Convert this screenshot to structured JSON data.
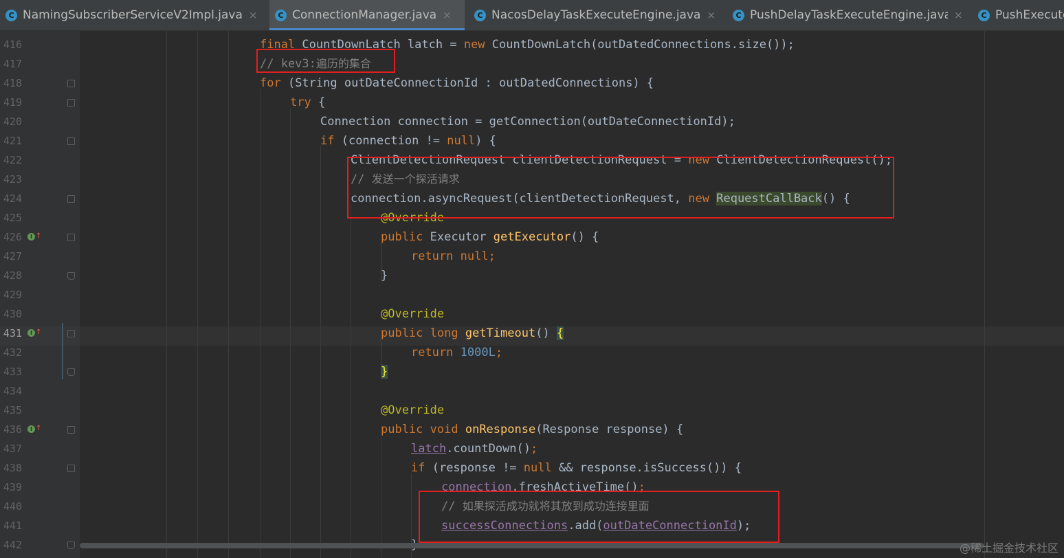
{
  "tabs": [
    {
      "label": "NamingSubscriberServiceV2Impl.java",
      "icon": "class-icon",
      "active": false
    },
    {
      "label": "ConnectionManager.java",
      "icon": "class-icon",
      "active": true
    },
    {
      "label": "NacosDelayTaskExecuteEngine.java",
      "icon": "class-icon",
      "active": false
    },
    {
      "label": "PushDelayTaskExecuteEngine.java",
      "icon": "class-icon",
      "active": false
    },
    {
      "label": "PushExecute",
      "icon": "class-icon",
      "active": false
    }
  ],
  "tab_icon_glyph": "C",
  "tab_close_glyph": "×",
  "current_line": "431",
  "lines": [
    {
      "num": "416",
      "t1": "final ",
      "t2": "CountDownLatch latch = ",
      "t3": "new ",
      "t4": "CountDownLatch(outDatedConnections.size());"
    },
    {
      "num": "417",
      "t1": "// kev3:",
      "t2": "遍历的集合"
    },
    {
      "num": "418",
      "t1": "for ",
      "t2": "(String outDateConnectionId : outDatedConnections) {"
    },
    {
      "num": "419",
      "t1": "try ",
      "t2": "{"
    },
    {
      "num": "420",
      "t1": "Connection connection = getConnection(outDateConnectionId);"
    },
    {
      "num": "421",
      "t1": "if ",
      "t2": "(connection != ",
      "t3": "null",
      "t4": ") {"
    },
    {
      "num": "422",
      "t1": "ClientDetectionRequest clientDetectionRequest = ",
      "t2": "new ",
      "t3": "ClientDetectionRequest();"
    },
    {
      "num": "423",
      "t1": "// ",
      "t2": "发送一个探活请求"
    },
    {
      "num": "424",
      "t1": "connection.asyncRequest(clientDetectionRequest, ",
      "t2": "new ",
      "t3": "RequestCallBack",
      "t4": "() {"
    },
    {
      "num": "425",
      "t1": "@Override"
    },
    {
      "num": "426",
      "t1": "public ",
      "t2": "Executor ",
      "t3": "getExecutor",
      "t4": "() {"
    },
    {
      "num": "427",
      "t1": "return ",
      "t2": "null",
      "t3": ";"
    },
    {
      "num": "428",
      "t1": "}"
    },
    {
      "num": "429"
    },
    {
      "num": "430",
      "t1": "@Override"
    },
    {
      "num": "431",
      "t1": "public ",
      "t2": "long ",
      "t3": "getTimeout",
      "t4": "() ",
      "t5": "{"
    },
    {
      "num": "432",
      "t1": "return ",
      "t2": "1000L",
      "t3": ";"
    },
    {
      "num": "433",
      "t1": "}"
    },
    {
      "num": "434"
    },
    {
      "num": "435",
      "t1": "@Override"
    },
    {
      "num": "436",
      "t1": "public ",
      "t2": "void ",
      "t3": "onResponse",
      "t4": "(Response response) {"
    },
    {
      "num": "437",
      "t1": "latch",
      "t2": ".countDown()",
      "t3": ";"
    },
    {
      "num": "438",
      "t1": "if ",
      "t2": "(response != ",
      "t3": "null ",
      "t4": "&& response.isSuccess()) {"
    },
    {
      "num": "439",
      "t1": "connection",
      "t2": ".freshActiveTime()",
      "t3": ";"
    },
    {
      "num": "440",
      "t1": "// ",
      "t2": "如果探活成功就将其放到成功连接里面"
    },
    {
      "num": "441",
      "t1": "successConnections",
      "t2": ".add(",
      "t3": "outDateConnectionId",
      "t4": ");"
    },
    {
      "num": "442",
      "t1": "}"
    }
  ],
  "gutter_marker_glyph": "I",
  "gutter_arrow_glyph": "↑",
  "watermark": "@稀土掘金技术社区"
}
